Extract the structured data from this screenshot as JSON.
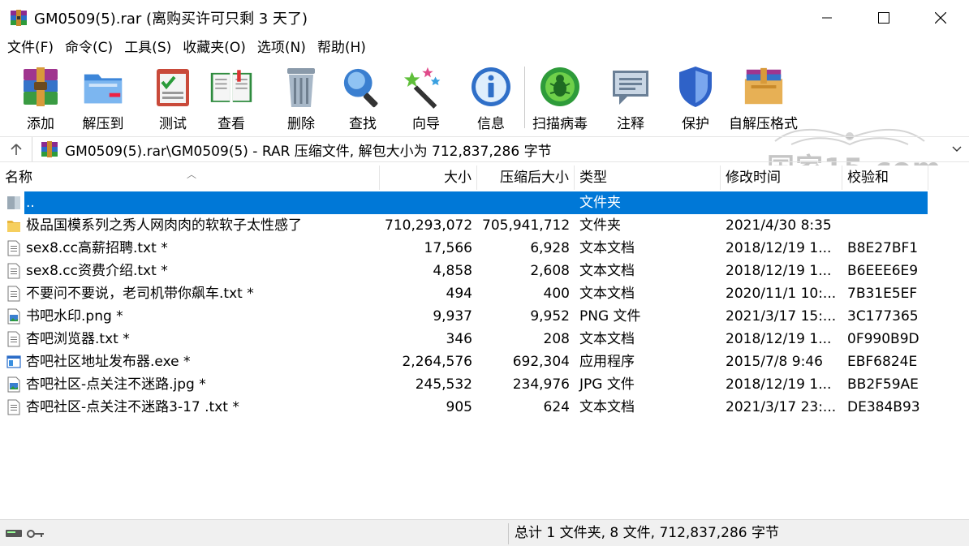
{
  "window": {
    "title": "GM0509(5).rar (离购买许可只剩 3 天了)"
  },
  "menu": [
    "文件(F)",
    "命令(C)",
    "工具(S)",
    "收藏夹(O)",
    "选项(N)",
    "帮助(H)"
  ],
  "toolbar": [
    {
      "label": "添加",
      "icon": "add-archive-icon"
    },
    {
      "label": "解压到",
      "icon": "extract-to-icon"
    },
    {
      "label": "测试",
      "icon": "test-icon"
    },
    {
      "label": "查看",
      "icon": "view-icon"
    },
    {
      "label": "删除",
      "icon": "delete-icon"
    },
    {
      "label": "查找",
      "icon": "find-icon"
    },
    {
      "label": "向导",
      "icon": "wizard-icon"
    },
    {
      "label": "信息",
      "icon": "info-icon"
    },
    {
      "label": "扫描病毒",
      "icon": "virus-scan-icon"
    },
    {
      "label": "注释",
      "icon": "comment-icon"
    },
    {
      "label": "保护",
      "icon": "protect-icon"
    },
    {
      "label": "自解压格式",
      "icon": "sfx-icon"
    }
  ],
  "watermark": "国家15.com",
  "address": {
    "path": "GM0509(5).rar\\GM0509(5) - RAR 压缩文件, 解包大小为 712,837,286 字节"
  },
  "columns": {
    "name": "名称",
    "size": "大小",
    "packed": "压缩后大小",
    "type": "类型",
    "modified": "修改时间",
    "crc": "校验和"
  },
  "rows": [
    {
      "name": "..",
      "size": "",
      "packed": "",
      "type": "文件夹",
      "modified": "",
      "crc": "",
      "icon": "folder-up-icon",
      "selected": true
    },
    {
      "name": "极品国模系列之秀人网肉肉的软软子太性感了",
      "size": "710,293,072",
      "packed": "705,941,712",
      "type": "文件夹",
      "modified": "2021/4/30 8:35",
      "crc": "",
      "icon": "folder-icon"
    },
    {
      "name": "sex8.cc高薪招聘.txt *",
      "size": "17,566",
      "packed": "6,928",
      "type": "文本文档",
      "modified": "2018/12/19 1...",
      "crc": "B8E27BF1",
      "icon": "text-file-icon"
    },
    {
      "name": "sex8.cc资费介绍.txt *",
      "size": "4,858",
      "packed": "2,608",
      "type": "文本文档",
      "modified": "2018/12/19 1...",
      "crc": "B6EEE6E9",
      "icon": "text-file-icon"
    },
    {
      "name": "不要问不要说，老司机带你飙车.txt *",
      "size": "494",
      "packed": "400",
      "type": "文本文档",
      "modified": "2020/11/1 10:...",
      "crc": "7B31E5EF",
      "icon": "text-file-icon"
    },
    {
      "name": "书吧水印.png *",
      "size": "9,937",
      "packed": "9,952",
      "type": "PNG 文件",
      "modified": "2021/3/17 15:...",
      "crc": "3C177365",
      "icon": "image-file-icon"
    },
    {
      "name": "杏吧浏览器.txt *",
      "size": "346",
      "packed": "208",
      "type": "文本文档",
      "modified": "2018/12/19 1...",
      "crc": "0F990B9D",
      "icon": "text-file-icon"
    },
    {
      "name": "杏吧社区地址发布器.exe *",
      "size": "2,264,576",
      "packed": "692,304",
      "type": "应用程序",
      "modified": "2015/7/8 9:46",
      "crc": "EBF6824E",
      "icon": "exe-file-icon"
    },
    {
      "name": "杏吧社区-点关注不迷路.jpg *",
      "size": "245,532",
      "packed": "234,976",
      "type": "JPG 文件",
      "modified": "2018/12/19 1...",
      "crc": "BB2F59AE",
      "icon": "image-file-icon"
    },
    {
      "name": "杏吧社区-点关注不迷路3-17 .txt *",
      "size": "905",
      "packed": "624",
      "type": "文本文档",
      "modified": "2021/3/17 23:...",
      "crc": "DE384B93",
      "icon": "text-file-icon"
    }
  ],
  "status": {
    "summary": "总计 1 文件夹, 8 文件, 712,837,286 字节"
  },
  "colors": {
    "selection": "#0078d7",
    "folder": "#f3c34a"
  }
}
